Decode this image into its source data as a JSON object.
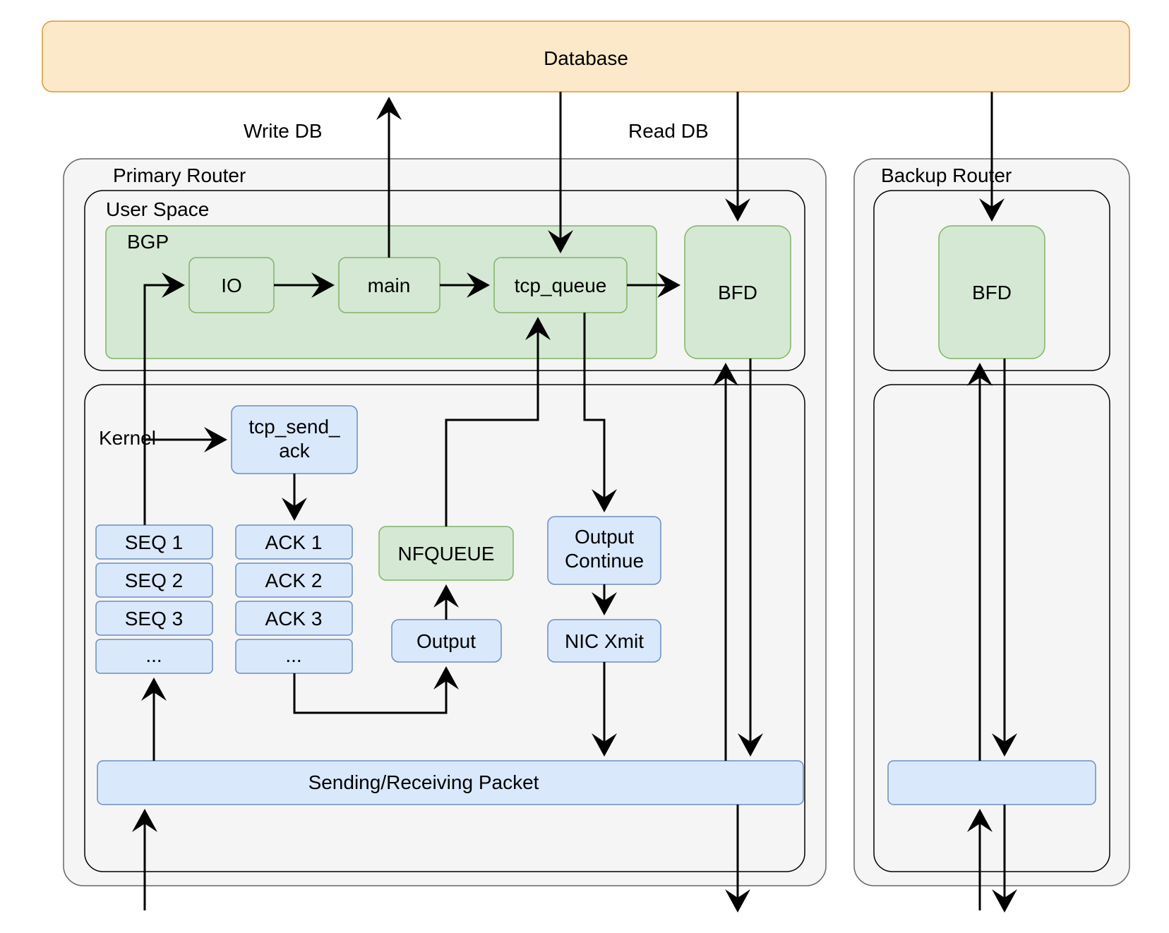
{
  "database": {
    "title": "Database"
  },
  "labels": {
    "write_db": "Write DB",
    "read_db": "Read DB"
  },
  "primary": {
    "title": "Primary Router",
    "userspace": {
      "title": "User Space",
      "bgp": {
        "title": "BGP",
        "io": "IO",
        "main": "main",
        "tcp_queue": "tcp_queue"
      },
      "bfd": "BFD"
    },
    "kernel": {
      "title": "Kernel",
      "tcp_send_ack": "tcp_send_\nack",
      "seq": [
        "SEQ 1",
        "SEQ 2",
        "SEQ 3",
        "..."
      ],
      "ack": [
        "ACK 1",
        "ACK 2",
        "ACK 3",
        "..."
      ],
      "nfqueue": "NFQUEUE",
      "output": "Output",
      "output_continue": "Output\nContinue",
      "nic_xmit": "NIC Xmit",
      "packet": "Sending/Receiving Packet"
    }
  },
  "backup": {
    "title": "Backup Router",
    "bfd": "BFD"
  }
}
